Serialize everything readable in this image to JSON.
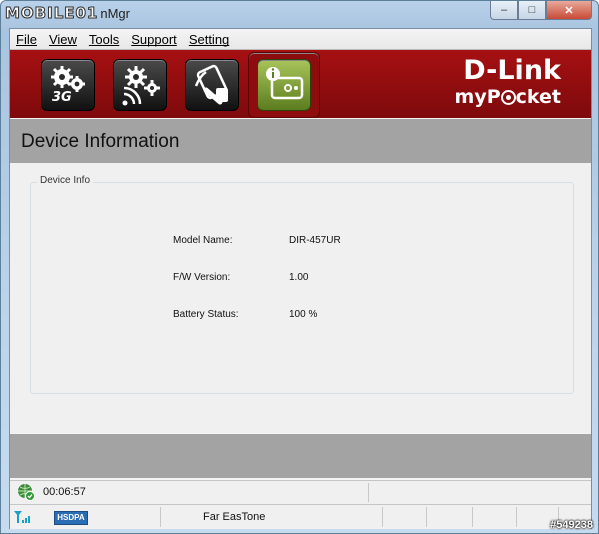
{
  "window": {
    "title_logo": "MOBILE01",
    "title_suffix": "nMgr",
    "controls": {
      "minimize": "–",
      "maximize": "□",
      "close": "✕"
    }
  },
  "menu": {
    "items": [
      {
        "label": "File"
      },
      {
        "label": "View"
      },
      {
        "label": "Tools"
      },
      {
        "label": "Support"
      },
      {
        "label": "Setting"
      }
    ]
  },
  "toolbar": {
    "buttons": [
      {
        "icon": "3g-settings-icon",
        "caption": "3G"
      },
      {
        "icon": "wireless-settings-icon"
      },
      {
        "icon": "sim-card-icon"
      },
      {
        "icon": "device-info-icon",
        "active": true
      }
    ],
    "brand_name": "D-Link",
    "product_name_left": "myP",
    "product_name_right": "cket"
  },
  "page": {
    "title": "Device Information"
  },
  "device_info": {
    "legend": "Device Info",
    "rows": [
      {
        "label": "Model Name:",
        "value": "DIR-457UR"
      },
      {
        "label": "F/W Version:",
        "value": "1.00"
      },
      {
        "label": "Battery Status:",
        "value": "100 %"
      }
    ]
  },
  "status": {
    "connection_time": "00:06:57",
    "network_type": "HSDPA",
    "carrier": "Far EasTone"
  },
  "watermark": "#549238",
  "colors": {
    "banner_red": "#9a0e10",
    "header_gray": "#a3a3a3",
    "active_icon_green": "#8aab3c"
  }
}
